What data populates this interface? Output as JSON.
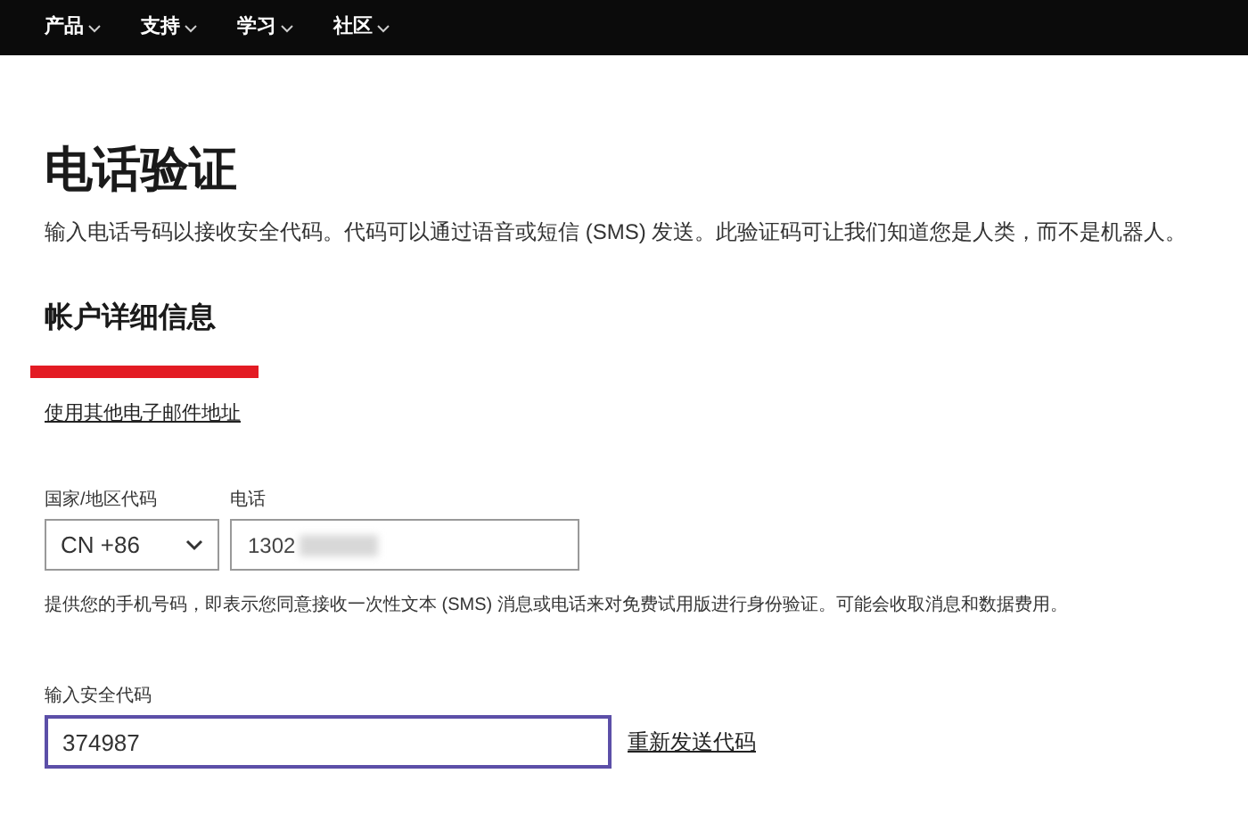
{
  "nav": {
    "items": [
      {
        "label": "产品"
      },
      {
        "label": "支持"
      },
      {
        "label": "学习"
      },
      {
        "label": "社区"
      }
    ]
  },
  "title": "电话验证",
  "intro": "输入电话号码以接收安全代码。代码可以通过语音或短信 (SMS) 发送。此验证码可让我们知道您是人类，而不是机器人。",
  "account": {
    "heading": "帐户详细信息",
    "redacted": true,
    "link": "使用其他电子邮件地址"
  },
  "phone": {
    "country_label": "国家/地区代码",
    "country_value": "CN +86",
    "phone_label": "电话",
    "phone_value": "1302",
    "blurred": true
  },
  "consent": "提供您的手机号码，即表示您同意接收一次性文本 (SMS) 消息或电话来对免费试用版进行身份验证。可能会收取消息和数据费用。",
  "code": {
    "label": "输入安全代码",
    "value": "374987",
    "focused": true,
    "resend": "重新发送代码"
  }
}
